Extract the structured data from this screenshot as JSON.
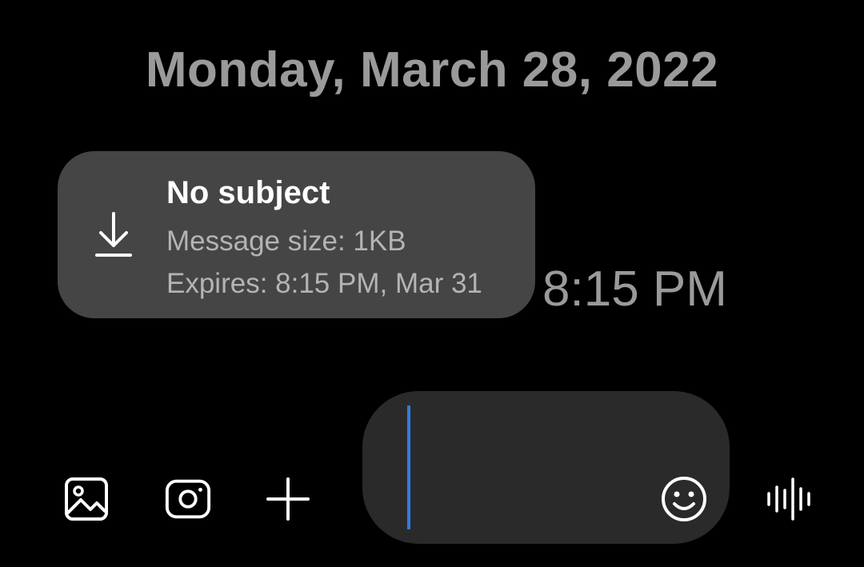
{
  "conversation": {
    "date_header": "Monday, March 28, 2022"
  },
  "mms_message": {
    "icon": "download-icon",
    "subject": "No subject",
    "size_text": "Message size: 1KB",
    "expires_text": "Expires: 8:15 PM, Mar 31",
    "time": "8:15 PM"
  },
  "composer": {
    "gallery_icon": "image-icon",
    "camera_icon": "camera-icon",
    "attach_icon": "plus-icon",
    "input_value": "",
    "emoji_icon": "emoji-icon",
    "voice_icon": "voice-waveform-icon",
    "cursor_color": "#2f7de1"
  },
  "colors": {
    "background": "#000000",
    "bubble": "#454545",
    "input_pill": "#2a2a2a",
    "secondary_text": "#9a9a9a"
  }
}
